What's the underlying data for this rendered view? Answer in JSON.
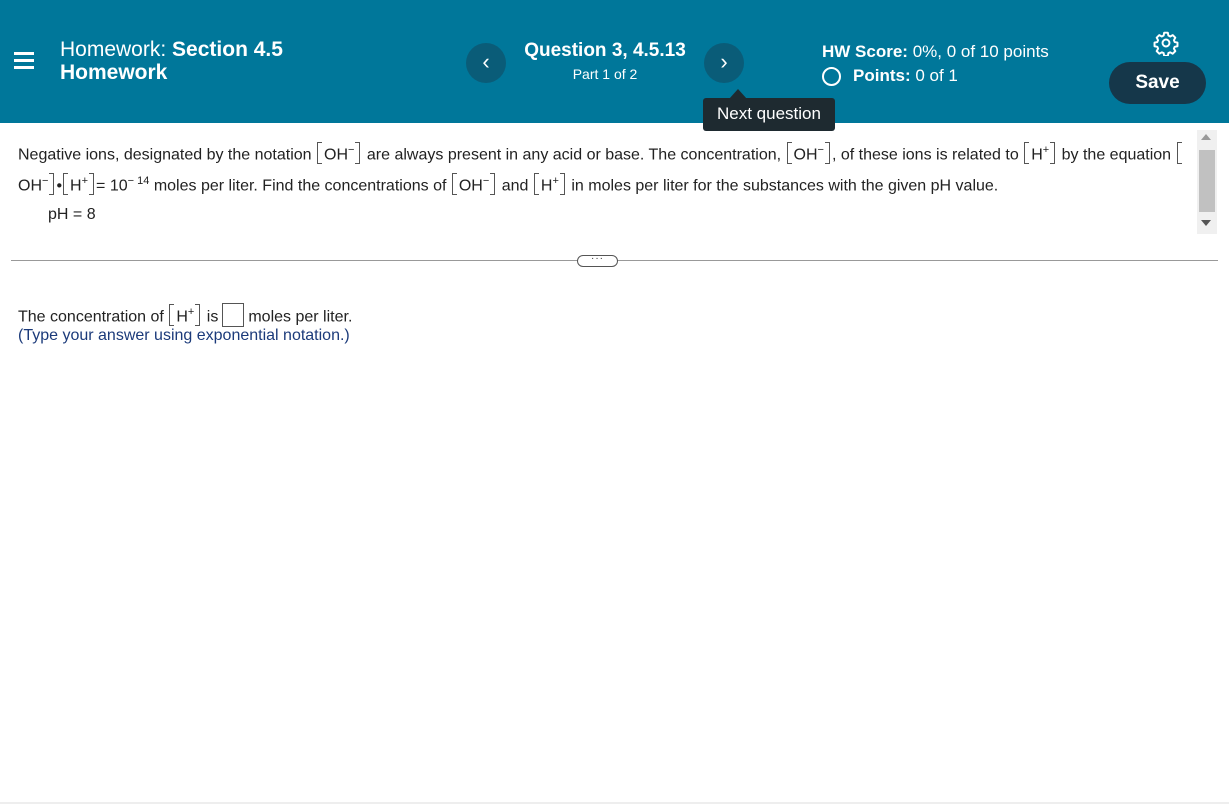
{
  "header": {
    "title_prefix": "Homework:",
    "title_bold": "Section 4.5",
    "title_line2": "Homework",
    "question_title": "Question 3, 4.5.13",
    "question_part": "Part 1 of 2",
    "prev_glyph": "‹",
    "next_glyph": "›",
    "hw_score_label": "HW Score:",
    "hw_score_value": "0%, 0 of 10 points",
    "points_label": "Points:",
    "points_value": "0 of 1",
    "save_label": "Save",
    "tooltip": "Next question",
    "colors": {
      "bar": "#00779a",
      "save": "#15374a"
    }
  },
  "question": {
    "t1": "Negative ions, designated by the notation",
    "oh": "OH",
    "minus": "−",
    "t2": "are always present in any acid or base. The concentration,",
    "t3": ", of these ions is related to",
    "h": "H",
    "plus": "+",
    "t4": "by the equation",
    "dot": "•",
    "eq": "= 10",
    "exp": "− 14",
    "t5": "moles per liter. Find the concentrations of",
    "and": "and",
    "t6": "in moles per liter for the substances with the given pH value.",
    "ph": "pH = 8"
  },
  "answer": {
    "t1": "The concentration of",
    "is": "is",
    "t2": "moles per liter.",
    "hint": "(Type your answer using exponential notation.)"
  },
  "divider": {
    "expand_label": "···"
  }
}
